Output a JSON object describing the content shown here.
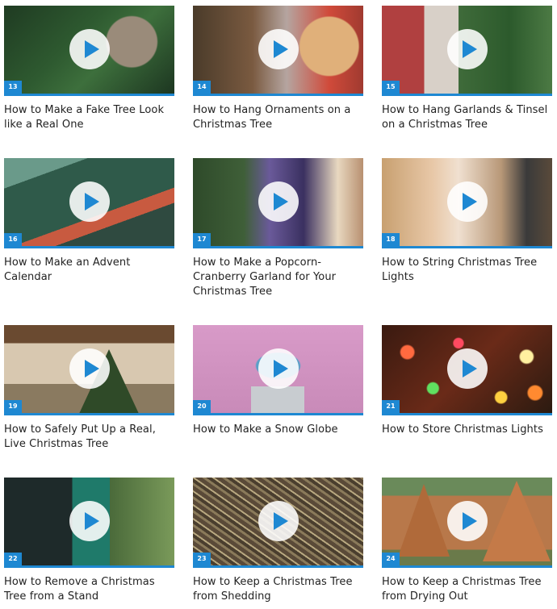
{
  "videos": [
    {
      "number": "13",
      "title": "How to Make a Fake Tree Look like a Real One"
    },
    {
      "number": "14",
      "title": "How to Hang Ornaments on a Christmas Tree"
    },
    {
      "number": "15",
      "title": "How to Hang Garlands & Tinsel on a Christmas Tree"
    },
    {
      "number": "16",
      "title": "How to Make an Advent Calendar"
    },
    {
      "number": "17",
      "title": "How to Make a Popcorn-Cranberry Garland for Your Christmas Tree"
    },
    {
      "number": "18",
      "title": "How to String Christmas Tree Lights"
    },
    {
      "number": "19",
      "title": "How to Safely Put Up a Real, Live Christmas Tree"
    },
    {
      "number": "20",
      "title": "How to Make a Snow Globe"
    },
    {
      "number": "21",
      "title": "How to Store Christmas Lights"
    },
    {
      "number": "22",
      "title": "How to Remove a Christmas Tree from a Stand"
    },
    {
      "number": "23",
      "title": "How to Keep a Christmas Tree from Shedding"
    },
    {
      "number": "24",
      "title": "How to Keep a Christmas Tree from Drying Out"
    }
  ],
  "colors": {
    "accent": "#1e88d2"
  },
  "icons": {
    "play": "play-icon"
  }
}
